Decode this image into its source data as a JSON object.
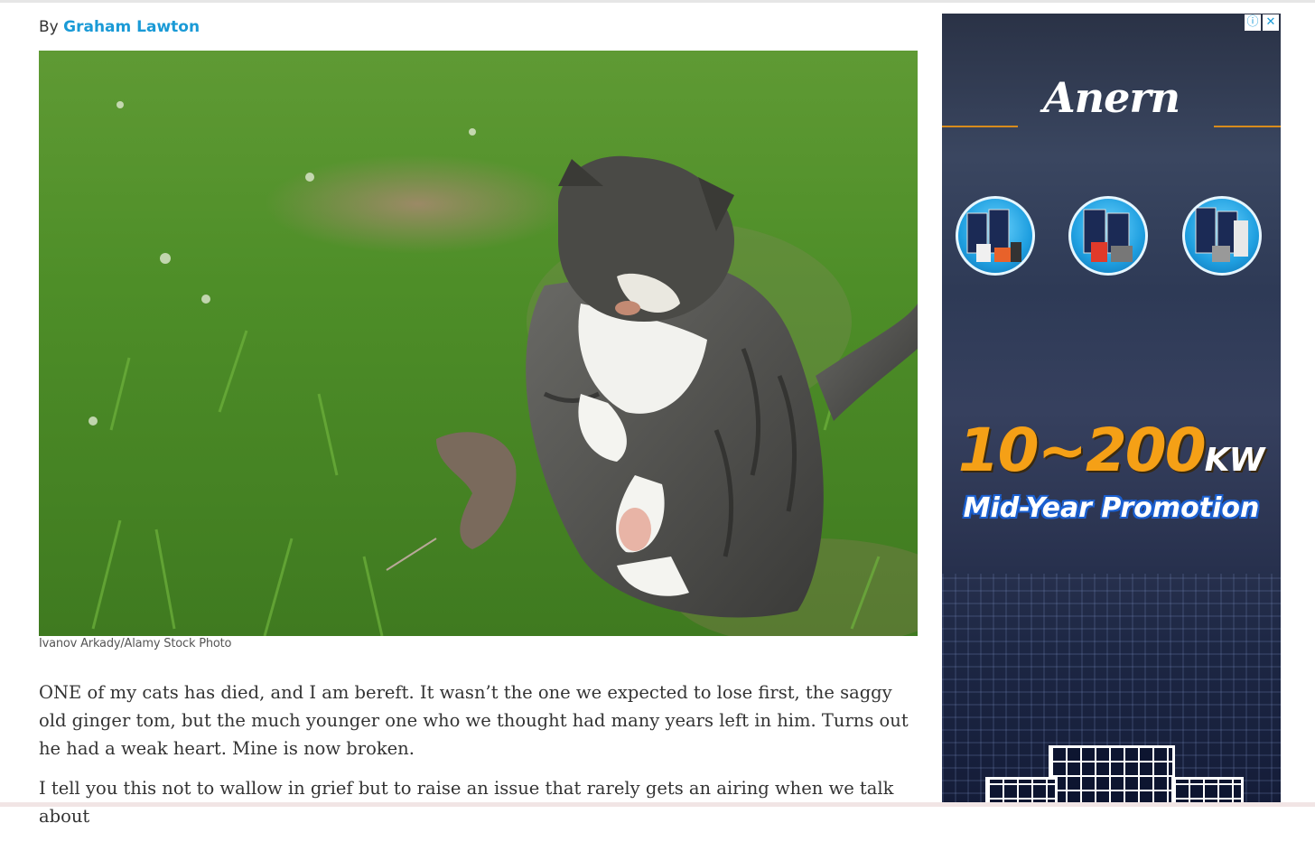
{
  "article": {
    "by_prefix": "By",
    "author": "Graham Lawton",
    "photo_alt": "Tabby cat playing with a mouse on grass",
    "caption": "Ivanov Arkady/Alamy Stock Photo",
    "paragraphs": [
      "ONE of my cats has died, and I am bereft. It wasn’t the one we expected to lose first, the saggy old ginger tom, but the much younger one who we thought had many years left in him. Turns out he had a weak heart. Mine is now broken.",
      "I tell you this not to wallow in grief but to raise an issue that rarely gets an airing when we talk about"
    ]
  },
  "ad": {
    "info_icon": "info-icon",
    "close_icon": "close-icon",
    "brand": "Anern",
    "power_range": "10~200",
    "power_unit": "KW",
    "promo": "Mid-Year Promotion",
    "colors": {
      "accent_orange": "#f5a016",
      "promo_blue": "#1a5fd0",
      "background": "#2c3552"
    }
  },
  "colors": {
    "author_link": "#1a9ad6",
    "body_text": "#333333"
  }
}
